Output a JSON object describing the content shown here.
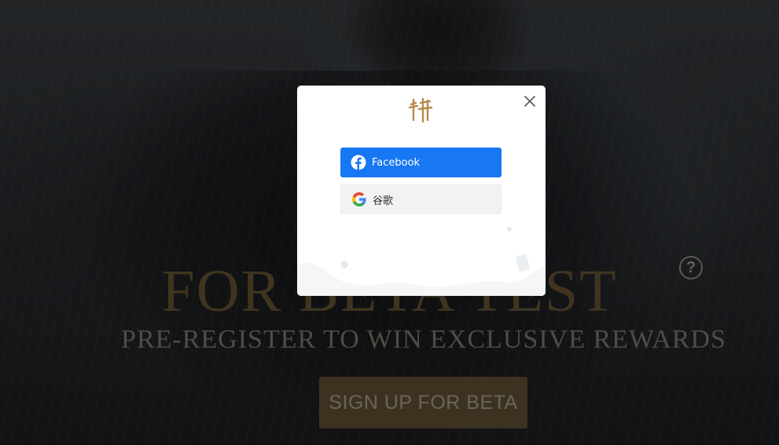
{
  "hero": {
    "title": "FOR BETA TEST",
    "subtitle": "PRE-REGISTER TO WIN EXCLUSIVE REWARDS",
    "signup_label": "SIGN UP FOR BETA",
    "help_label": "?"
  },
  "modal": {
    "logo_icon": "game-logo-icon",
    "close_icon": "close-icon",
    "buttons": [
      {
        "label": "Facebook",
        "icon": "facebook-icon",
        "bg": "#1877f2"
      },
      {
        "label": "谷歌",
        "icon": "google-icon",
        "bg": "#f2f2f2"
      }
    ]
  },
  "colors": {
    "gold": "#6e5a38",
    "facebook_blue": "#1877f2"
  }
}
